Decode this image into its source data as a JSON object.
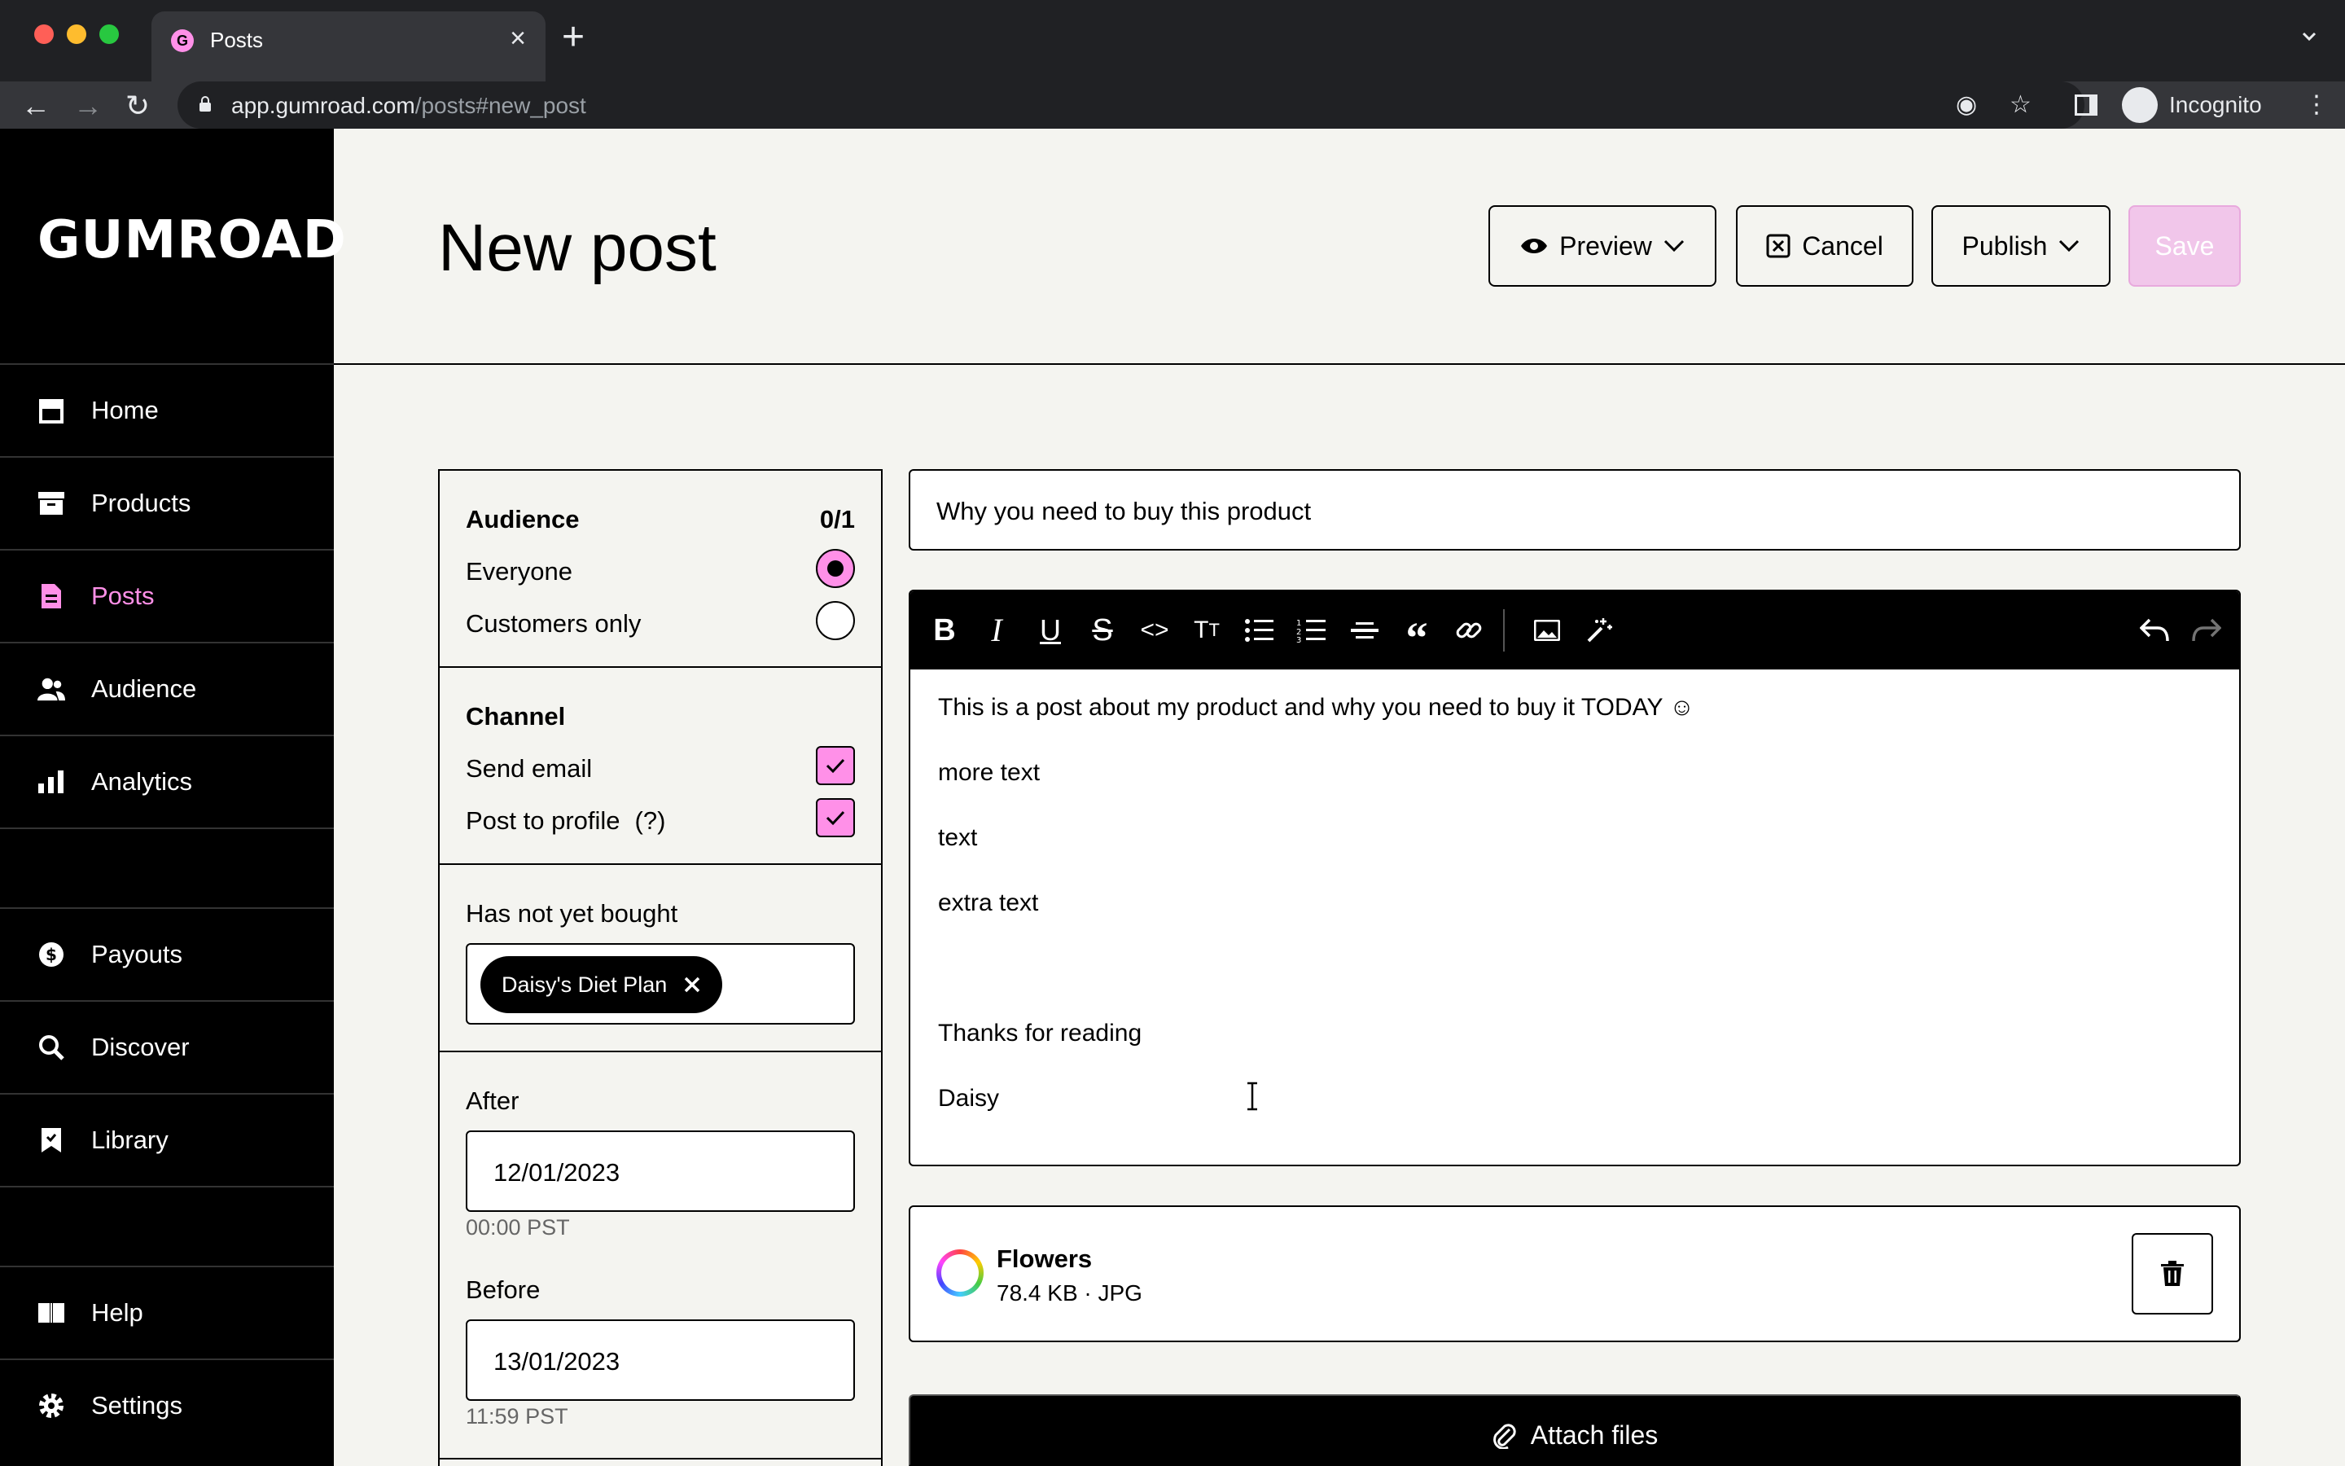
{
  "browser": {
    "tab_title": "Posts",
    "favicon_letter": "G",
    "url_domain": "app.gumroad.com",
    "url_path": "/posts#new_post",
    "profile_label": "Incognito"
  },
  "sidebar": {
    "logo": "GUMROAD",
    "items": [
      {
        "label": "Home",
        "icon": "store-icon"
      },
      {
        "label": "Products",
        "icon": "archive-icon"
      },
      {
        "label": "Posts",
        "icon": "document-icon",
        "active": true
      },
      {
        "label": "Audience",
        "icon": "people-icon"
      },
      {
        "label": "Analytics",
        "icon": "bar-chart-icon"
      },
      {
        "label": "Payouts",
        "icon": "dollar-icon"
      },
      {
        "label": "Discover",
        "icon": "search-icon"
      },
      {
        "label": "Library",
        "icon": "bookmark-icon"
      },
      {
        "label": "Help",
        "icon": "book-icon"
      },
      {
        "label": "Settings",
        "icon": "gear-icon"
      }
    ]
  },
  "header": {
    "title": "New post",
    "preview_label": "Preview",
    "cancel_label": "Cancel",
    "publish_label": "Publish",
    "save_label": "Save"
  },
  "audience": {
    "title": "Audience",
    "count": "0/1",
    "options": [
      {
        "label": "Everyone",
        "selected": true
      },
      {
        "label": "Customers only",
        "selected": false
      }
    ]
  },
  "channel": {
    "title": "Channel",
    "send_email": {
      "label": "Send email",
      "checked": true
    },
    "post_to_profile": {
      "label": "Post to profile",
      "help": "(?)",
      "checked": true
    }
  },
  "filters": {
    "has_not_bought_label": "Has not yet bought",
    "product_chip": "Daisy's Diet Plan",
    "after_label": "After",
    "after_date": "12/01/2023",
    "after_time": "00:00 PST",
    "before_label": "Before",
    "before_date": "13/01/2023",
    "before_time": "11:59 PST"
  },
  "post": {
    "title": "Why you need to buy this product",
    "body": [
      "This is a post about my product and why you need to buy it TODAY ☺",
      "more text",
      "text",
      "extra text",
      "Thanks for reading",
      "Daisy"
    ]
  },
  "attachment": {
    "name": "Flowers",
    "meta": "78.4 KB · JPG"
  },
  "attach_label": "Attach files",
  "colors": {
    "accent": "#ff90e8",
    "background": "#f4f4f0",
    "sidebar": "#000000"
  }
}
